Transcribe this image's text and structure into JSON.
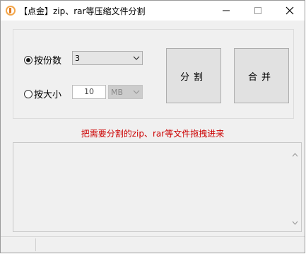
{
  "window": {
    "title": "【点金】zip、rar等压缩文件分割",
    "icon": "app-logo-icon",
    "controls": [
      "minimize-icon",
      "maximize-icon",
      "close-icon"
    ]
  },
  "split_options": {
    "by_count": {
      "label": "按份数",
      "selected": true,
      "value": "3"
    },
    "by_size": {
      "label": "按大小",
      "selected": false,
      "size_value": "10",
      "unit": "MB"
    }
  },
  "buttons": {
    "split": "分割",
    "merge": "合并"
  },
  "hint": "把需要分割的zip、rar等文件拖拽进来",
  "colors": {
    "hint": "#cc0000",
    "window_bg": "#f0f0f0"
  }
}
